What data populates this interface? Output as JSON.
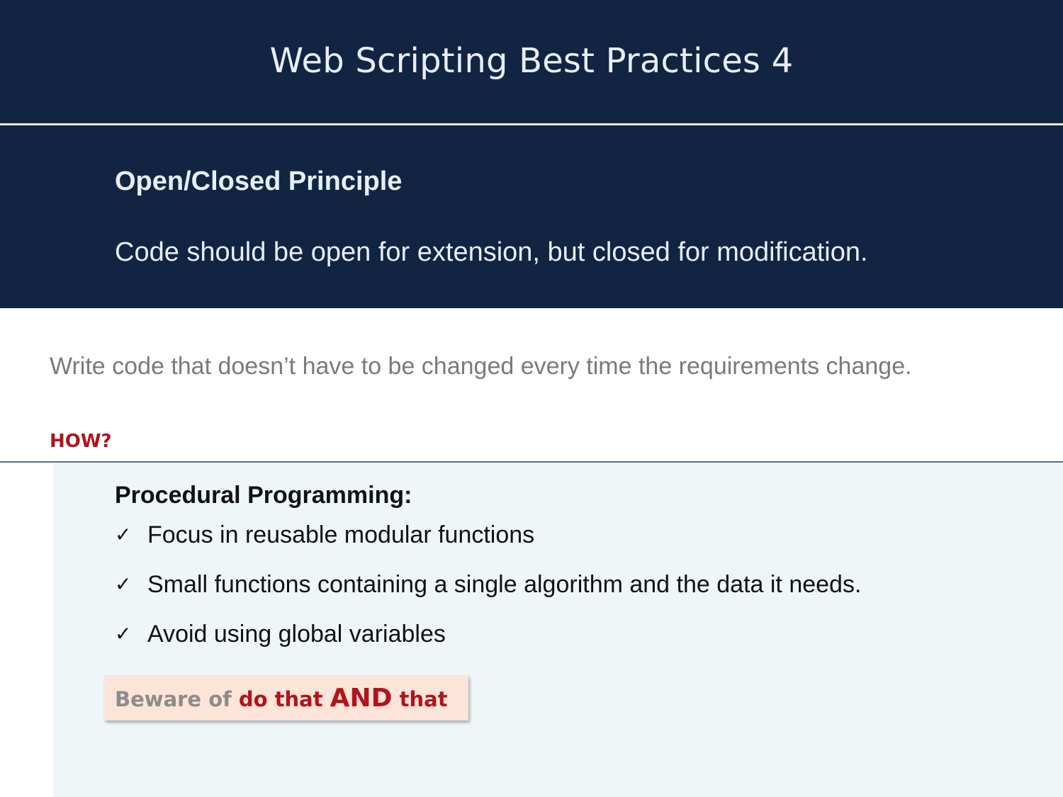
{
  "slide": {
    "title": "Web Scripting Best Practices 4"
  },
  "principle": {
    "heading": "Open/Closed Principle",
    "statement": "Code should be open for extension, but closed for modification."
  },
  "intro": "Write code that doesn’t have to be changed every time the requirements change.",
  "how_label": "HOW?",
  "panel": {
    "heading": "Procedural Programming:",
    "bullets": [
      "Focus in reusable modular functions",
      "Small functions containing a single algorithm and the data it needs.",
      "Avoid using global variables"
    ],
    "check_glyph": "✓",
    "icon": "checkmark-icon"
  },
  "callout": {
    "lead": "Beware of ",
    "emphasis_1": "do that ",
    "emphasis_2": "AND",
    "emphasis_3": " that"
  },
  "colors": {
    "header_bg": "#112543",
    "header_text": "#e8eef6",
    "accent_red": "#b0141c",
    "panel_bg": "#eef6f8",
    "callout_bg": "#fce4d8",
    "rule": "#4f7392"
  }
}
